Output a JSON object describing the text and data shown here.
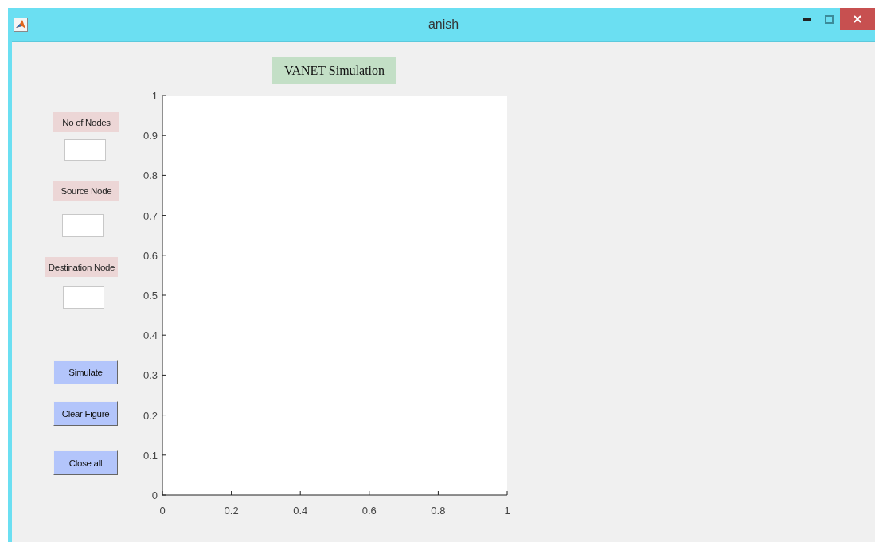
{
  "window": {
    "title": "anish"
  },
  "figure_title": "VANET Simulation",
  "fields": [
    {
      "label": "No of Nodes"
    },
    {
      "label": "Source Node"
    },
    {
      "label": "Destination Node"
    }
  ],
  "buttons": [
    "Simulate",
    "Clear Figure",
    "Close all"
  ],
  "axes": {
    "chart_data": {
      "type": "line",
      "xlim": [
        0,
        1
      ],
      "ylim": [
        0,
        1
      ],
      "xticks": [
        0,
        0.2,
        0.4,
        0.6,
        0.8,
        1
      ],
      "yticks": [
        0,
        0.1,
        0.2,
        0.3,
        0.4,
        0.5,
        0.6,
        0.7,
        0.8,
        0.9,
        1
      ]
    }
  }
}
